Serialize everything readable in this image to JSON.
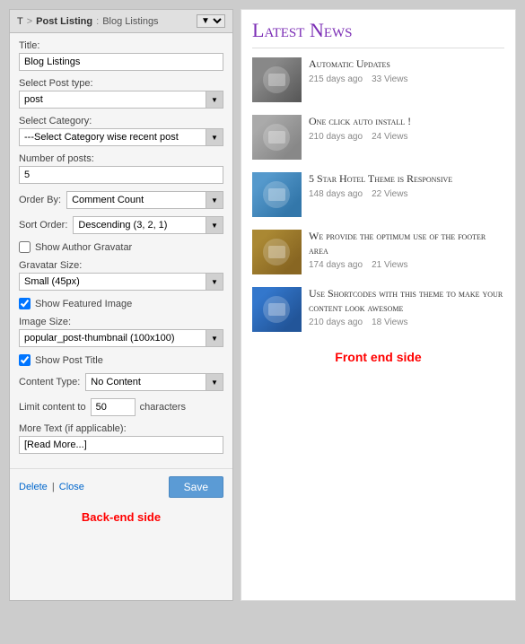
{
  "left_panel": {
    "header": {
      "t_label": "T",
      "sep": ">",
      "post_listing": "Post Listing",
      "colon_sep": ":",
      "blog_listings": "Blog Listings",
      "dropdown_arrow": "▼"
    },
    "fields": {
      "title_label": "Title:",
      "title_value": "Blog Listings",
      "post_type_label": "Select Post type:",
      "post_type_value": "post",
      "category_label": "Select Category:",
      "category_value": "---Select Category wise recent post",
      "num_posts_label": "Number of posts:",
      "num_posts_value": "5",
      "order_by_label": "Order By:",
      "order_by_value": "Comment Count",
      "sort_order_label": "Sort Order:",
      "sort_order_value": "Descending (3, 2, 1)",
      "show_author_label": "Show Author Gravatar",
      "gravatar_size_label": "Gravatar Size:",
      "gravatar_size_value": "Small (45px)",
      "show_featured_label": "Show Featured Image",
      "image_size_label": "Image Size:",
      "image_size_value": "popular_post-thumbnail (100x100)",
      "show_post_title_label": "Show Post Title",
      "content_type_label": "Content Type:",
      "content_type_value": "No Content",
      "limit_content_label": "Limit content to",
      "limit_content_value": "50",
      "limit_content_suffix": "characters",
      "more_text_label": "More Text (if applicable):",
      "more_text_value": "[Read More...]"
    },
    "footer": {
      "delete_label": "Delete",
      "pipe": "|",
      "close_label": "Close",
      "save_label": "Save"
    },
    "back_end_label": "Back-end side"
  },
  "right_panel": {
    "title": "Latest News",
    "news_items": [
      {
        "title": "Automatic Updates",
        "days_ago": "215 days ago",
        "views": "33 Views",
        "thumb_class": "thumb-1"
      },
      {
        "title": "One click auto install !",
        "days_ago": "210 days ago",
        "views": "24 Views",
        "thumb_class": "thumb-2"
      },
      {
        "title": "5 Star Hotel Theme is Responsive",
        "days_ago": "148 days ago",
        "views": "22 Views",
        "thumb_class": "thumb-3"
      },
      {
        "title": "We provide the optimum use of the footer area",
        "days_ago": "174 days ago",
        "views": "21 Views",
        "thumb_class": "thumb-4"
      },
      {
        "title": "Use Shortcodes with this theme to make your content look awesome",
        "days_ago": "210 days ago",
        "views": "18 Views",
        "thumb_class": "thumb-5"
      }
    ],
    "front_end_label": "Front end side"
  }
}
